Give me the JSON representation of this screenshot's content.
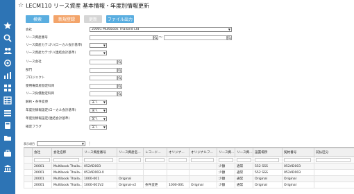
{
  "title": "LECM110 リース資産 基本情報・年度別情報更新",
  "toolbar": {
    "search": "検索",
    "new": "新規登録",
    "update": "更新",
    "export": "ファイル出力"
  },
  "form": {
    "company_label": "会社",
    "company_value": "20001 Multibook Thailand Ltd",
    "lease_no_label": "リース資産番号",
    "range_sep": "～",
    "cat_local_label": "リース資産カテゴリ(ローカル会計基準)",
    "cat_consol_label": "リース資産カテゴリ(連結会計基準)",
    "lessor_label": "リース会社",
    "dept_label": "部門",
    "project_label": "プロジェクト",
    "acct_label": "使用権資産勘定科目",
    "debt_label": "リース負債勘定科目",
    "cancel_label": "解約・条件変更",
    "cancel_value": "全て",
    "fy_local_label": "年度別情報設定(ローカル会計基準)",
    "fy_local_value": "全て",
    "fy_consol_label": "年度別情報設定(連結会計基準)",
    "fy_consol_value": "全て",
    "confirm_label": "確定フラグ",
    "confirm_value": "全て"
  },
  "grid": {
    "view_label": "表示項目",
    "columns": [
      "",
      "会社",
      "会社名称",
      "リース資産番号",
      "リース資産名...",
      "レコード...",
      "オリジナ...",
      "オリジナルフ...",
      "リース資...",
      "リース資...",
      "設置場所",
      "契約番号",
      "前払区分"
    ],
    "rows": [
      [
        "",
        "20001",
        "Multibook Thaila...",
        "052AD003",
        "",
        "",
        "",
        "",
        "少額",
        "通常",
        "552 SSS",
        "052AD003",
        ""
      ],
      [
        "",
        "20001",
        "Multibook Thaila...",
        "052AD003-X",
        "",
        "",
        "",
        "",
        "少額",
        "通常",
        "552 SSS",
        "052AD003",
        ""
      ],
      [
        "",
        "20001",
        "Multibook Thaila...",
        "1000-001",
        "Original",
        "",
        "",
        "",
        "少額",
        "通常",
        "Original",
        "Original",
        ""
      ],
      [
        "",
        "20001",
        "Multibook Thaila...",
        "1000-001V2",
        "Original-v2",
        "条件変更",
        "1000-001",
        "Original",
        "少額",
        "通常",
        "Original",
        "Original",
        ""
      ]
    ]
  },
  "rail_icons": [
    "star-icon",
    "search-icon",
    "people-icon",
    "sync-icon",
    "chart-icon",
    "grid-icon",
    "table-icon",
    "list-icon",
    "calc-icon",
    "folder-icon",
    "briefcase-icon",
    "bank-icon"
  ],
  "colors": {
    "rail": "#2d74b5",
    "search_btn": "#5aaee0",
    "new_btn": "#f3a46a",
    "update_btn": "#d6d6d6"
  }
}
